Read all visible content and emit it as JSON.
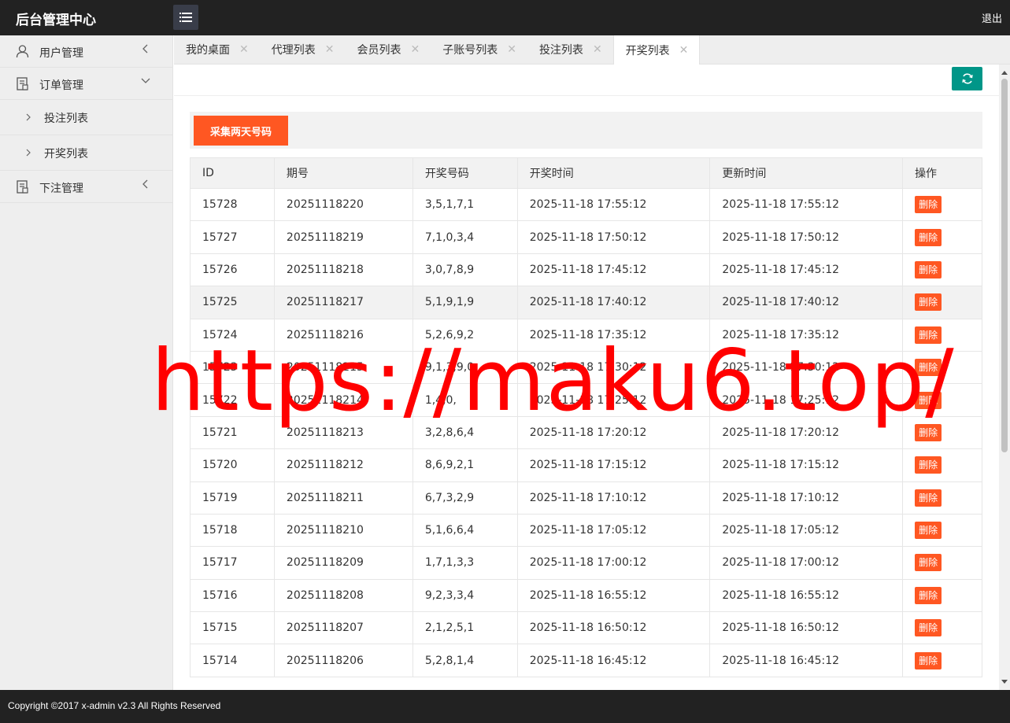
{
  "header": {
    "brand": "后台管理中心",
    "logout": "退出"
  },
  "sidebar": {
    "items": [
      {
        "label": "用户管理",
        "icon": "user-icon",
        "arrow": "chevron-left"
      },
      {
        "label": "订单管理",
        "icon": "document-icon",
        "arrow": "chevron-down"
      },
      {
        "label": "投注列表",
        "sub": true
      },
      {
        "label": "开奖列表",
        "sub": true
      },
      {
        "label": "下注管理",
        "icon": "document-icon",
        "arrow": "chevron-left"
      }
    ]
  },
  "tabs": [
    {
      "label": "我的桌面",
      "active": false
    },
    {
      "label": "代理列表",
      "active": false
    },
    {
      "label": "会员列表",
      "active": false
    },
    {
      "label": "子账号列表",
      "active": false
    },
    {
      "label": "投注列表",
      "active": false
    },
    {
      "label": "开奖列表",
      "active": true
    }
  ],
  "toolbar": {
    "collect_label": "采集两天号码"
  },
  "table": {
    "headers": [
      "ID",
      "期号",
      "开奖号码",
      "开奖时间",
      "更新时间",
      "操作"
    ],
    "delete_label": "删除",
    "rows": [
      {
        "id": "15728",
        "issue": "20251118220",
        "numbers": "3,5,1,7,1",
        "draw_time": "2025-11-18 17:55:12",
        "update_time": "2025-11-18 17:55:12"
      },
      {
        "id": "15727",
        "issue": "20251118219",
        "numbers": "7,1,0,3,4",
        "draw_time": "2025-11-18 17:50:12",
        "update_time": "2025-11-18 17:50:12"
      },
      {
        "id": "15726",
        "issue": "20251118218",
        "numbers": "3,0,7,8,9",
        "draw_time": "2025-11-18 17:45:12",
        "update_time": "2025-11-18 17:45:12"
      },
      {
        "id": "15725",
        "issue": "20251118217",
        "numbers": "5,1,9,1,9",
        "draw_time": "2025-11-18 17:40:12",
        "update_time": "2025-11-18 17:40:12"
      },
      {
        "id": "15724",
        "issue": "20251118216",
        "numbers": "5,2,6,9,2",
        "draw_time": "2025-11-18 17:35:12",
        "update_time": "2025-11-18 17:35:12"
      },
      {
        "id": "15723",
        "issue": "20251118215",
        "numbers": "9,1,3,9,0",
        "draw_time": "2025-11-18 17:30:12",
        "update_time": "2025-11-18 17:30:12"
      },
      {
        "id": "15722",
        "issue": "20251118214",
        "numbers": "1,4,0,",
        "draw_time": "2025-11-18 17:25:12",
        "update_time": "2025-11-18 17:25:12"
      },
      {
        "id": "15721",
        "issue": "20251118213",
        "numbers": "3,2,8,6,4",
        "draw_time": "2025-11-18 17:20:12",
        "update_time": "2025-11-18 17:20:12"
      },
      {
        "id": "15720",
        "issue": "20251118212",
        "numbers": "8,6,9,2,1",
        "draw_time": "2025-11-18 17:15:12",
        "update_time": "2025-11-18 17:15:12"
      },
      {
        "id": "15719",
        "issue": "20251118211",
        "numbers": "6,7,3,2,9",
        "draw_time": "2025-11-18 17:10:12",
        "update_time": "2025-11-18 17:10:12"
      },
      {
        "id": "15718",
        "issue": "20251118210",
        "numbers": "5,1,6,6,4",
        "draw_time": "2025-11-18 17:05:12",
        "update_time": "2025-11-18 17:05:12"
      },
      {
        "id": "15717",
        "issue": "20251118209",
        "numbers": "1,7,1,3,3",
        "draw_time": "2025-11-18 17:00:12",
        "update_time": "2025-11-18 17:00:12"
      },
      {
        "id": "15716",
        "issue": "20251118208",
        "numbers": "9,2,3,3,4",
        "draw_time": "2025-11-18 16:55:12",
        "update_time": "2025-11-18 16:55:12"
      },
      {
        "id": "15715",
        "issue": "20251118207",
        "numbers": "2,1,2,5,1",
        "draw_time": "2025-11-18 16:50:12",
        "update_time": "2025-11-18 16:50:12"
      },
      {
        "id": "15714",
        "issue": "20251118206",
        "numbers": "5,2,8,1,4",
        "draw_time": "2025-11-18 16:45:12",
        "update_time": "2025-11-18 16:45:12"
      }
    ]
  },
  "watermark": "https://maku6.top/",
  "footer": {
    "copyright": "Copyright ©2017 x-admin v2.3 All Rights Reserved"
  },
  "colors": {
    "header_bg": "#222222",
    "accent_orange": "#FF5722",
    "accent_teal": "#009688",
    "watermark_red": "#FF0000"
  }
}
